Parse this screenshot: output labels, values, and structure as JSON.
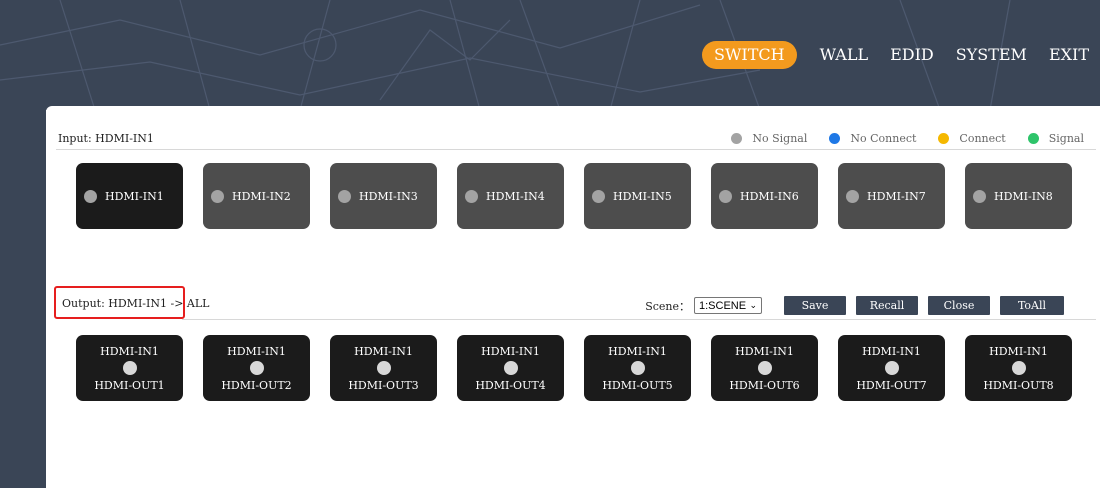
{
  "nav": {
    "items": [
      {
        "label": "SWITCH",
        "active": true
      },
      {
        "label": "WALL",
        "active": false
      },
      {
        "label": "EDID",
        "active": false
      },
      {
        "label": "SYSTEM",
        "active": false
      },
      {
        "label": "EXIT",
        "active": false
      }
    ]
  },
  "colors": {
    "header_bg": "#3a4556",
    "accent": "#f39a1e",
    "tile_dark": "#1b1b1b",
    "tile_gray": "#4d4d4d",
    "highlight": "#e61e1e"
  },
  "input": {
    "label": "Input:  HDMI-IN1",
    "legend": [
      {
        "label": "No Signal",
        "color": "#a3a3a3"
      },
      {
        "label": "No Connect",
        "color": "#1e78e6"
      },
      {
        "label": "Connect",
        "color": "#f5b800"
      },
      {
        "label": "Signal",
        "color": "#2ec46a"
      }
    ],
    "tiles": [
      {
        "label": "HDMI-IN1",
        "selected": true
      },
      {
        "label": "HDMI-IN2",
        "selected": false
      },
      {
        "label": "HDMI-IN3",
        "selected": false
      },
      {
        "label": "HDMI-IN4",
        "selected": false
      },
      {
        "label": "HDMI-IN5",
        "selected": false
      },
      {
        "label": "HDMI-IN6",
        "selected": false
      },
      {
        "label": "HDMI-IN7",
        "selected": false
      },
      {
        "label": "HDMI-IN8",
        "selected": false
      }
    ]
  },
  "output": {
    "label": "Output:  HDMI-IN1 -> ALL",
    "scene_label": "Scene：",
    "scene_value": "1:SCENE",
    "buttons": [
      "Save",
      "Recall",
      "Close",
      "ToAll"
    ],
    "tiles": [
      {
        "source": "HDMI-IN1",
        "name": "HDMI-OUT1"
      },
      {
        "source": "HDMI-IN1",
        "name": "HDMI-OUT2"
      },
      {
        "source": "HDMI-IN1",
        "name": "HDMI-OUT3"
      },
      {
        "source": "HDMI-IN1",
        "name": "HDMI-OUT4"
      },
      {
        "source": "HDMI-IN1",
        "name": "HDMI-OUT5"
      },
      {
        "source": "HDMI-IN1",
        "name": "HDMI-OUT6"
      },
      {
        "source": "HDMI-IN1",
        "name": "HDMI-OUT7"
      },
      {
        "source": "HDMI-IN1",
        "name": "HDMI-OUT8"
      }
    ]
  }
}
